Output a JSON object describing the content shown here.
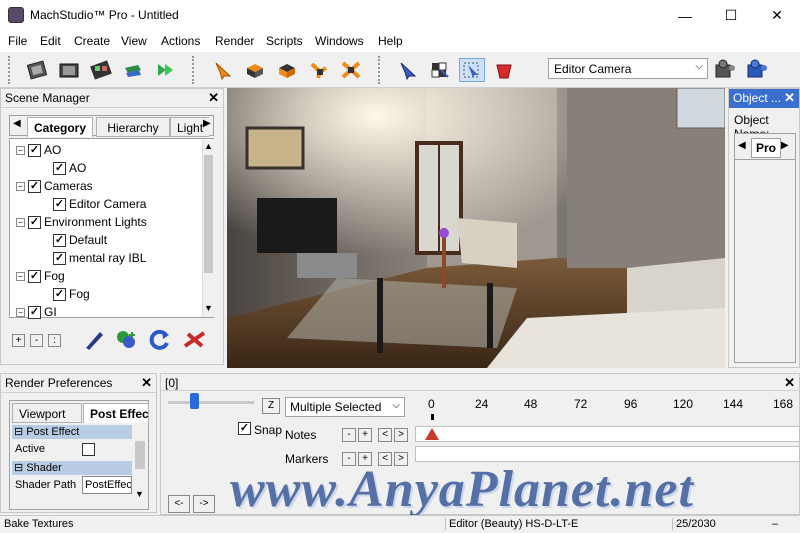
{
  "window": {
    "title": "MachStudio™ Pro - Untitled",
    "minimize": "—",
    "maximize": "☐",
    "close": "✕"
  },
  "menu": [
    "File",
    "Edit",
    "Create",
    "View",
    "Actions",
    "Render",
    "Scripts",
    "Windows",
    "Help"
  ],
  "toolbar": {
    "camera_select": "Editor Camera"
  },
  "scene_manager": {
    "title": "Scene Manager",
    "tabs": [
      "Category",
      "Hierarchy",
      "Light"
    ],
    "tree": [
      {
        "label": "AO",
        "level": 0
      },
      {
        "label": "AO",
        "level": 1
      },
      {
        "label": "Cameras",
        "level": 0
      },
      {
        "label": "Editor Camera",
        "level": 1
      },
      {
        "label": "Environment Lights",
        "level": 0
      },
      {
        "label": "Default",
        "level": 1
      },
      {
        "label": "mental ray IBL",
        "level": 1
      },
      {
        "label": "Fog",
        "level": 0
      },
      {
        "label": "Fog",
        "level": 1
      },
      {
        "label": "GI",
        "level": 0
      }
    ],
    "buttons": [
      "+",
      "-",
      ":"
    ]
  },
  "object_panel": {
    "title": "Object ...",
    "label": "Object Name:",
    "tab": "Pro"
  },
  "render_prefs": {
    "title": "Render Preferences",
    "tabs": [
      "Viewport",
      "Post Effec"
    ],
    "section_post": "Post Effect",
    "active_label": "Active",
    "section_shader": "Shader",
    "shader_path_label": "Shader Path",
    "shader_path_value": "PostEffec"
  },
  "timeline": {
    "header": "[0]",
    "z_button": "Z",
    "selection": "Multiple Selected",
    "snap": "Snap",
    "notes": "Notes",
    "markers": "Markers",
    "ticks": [
      "0",
      "24",
      "48",
      "72",
      "96",
      "120",
      "144",
      "168"
    ],
    "nav_prev": "<-",
    "nav_next": "->",
    "minus": "-",
    "plus": "+",
    "left": "<",
    "right": ">"
  },
  "status": {
    "left": "Bake Textures",
    "mode": "Editor (Beauty) HS-D-LT-E",
    "frame": "25/2030",
    "dash": "–"
  },
  "watermark": "www.AnyaPlanet.net"
}
